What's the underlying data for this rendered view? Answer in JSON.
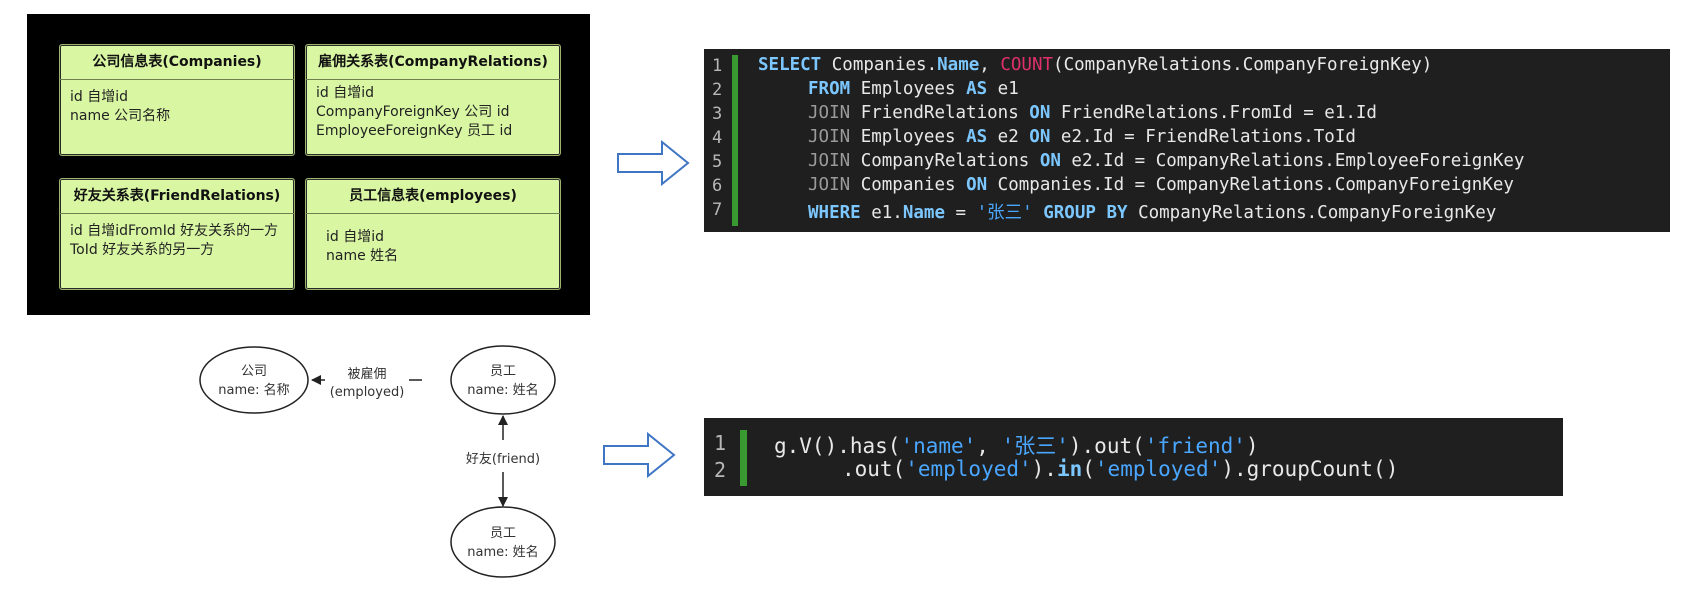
{
  "schema": {
    "companies": {
      "title": "公司信息表(Companies)",
      "fields": [
        "id 自增id",
        "name 公司名称"
      ]
    },
    "company_relations": {
      "title": "雇佣关系表(CompanyRelations)",
      "fields": [
        "id 自增id",
        "CompanyForeignKey 公司 id",
        "EmployeeForeignKey 员工 id"
      ]
    },
    "friend_relations": {
      "title": "好友关系表(FriendRelations)",
      "fields": [
        "id 自增idFromId 好友关系的一方",
        "ToId 好友关系的另一方"
      ]
    },
    "employees": {
      "title": "员工信息表(employees)",
      "fields": [
        "id 自增id",
        "name 姓名"
      ]
    }
  },
  "sql": {
    "line_numbers": [
      "1",
      "2",
      "3",
      "4",
      "5",
      "6",
      "7"
    ],
    "l1": {
      "kw1": "SELECT",
      "t1": " Companies.",
      "kw2": "Name",
      "t2": ", ",
      "fn": "COUNT",
      "t3": "(CompanyRelations.CompanyForeignKey)"
    },
    "l2": {
      "kw1": "FROM",
      "t1": " Employees ",
      "kw2": "AS",
      "t2": " e1"
    },
    "l3": {
      "jn": "JOIN",
      "t1": " FriendRelations ",
      "kw": "ON",
      "t2": " FriendRelations.FromId = e1.Id"
    },
    "l4": {
      "jn": "JOIN",
      "t1": " Employees ",
      "kw1": "AS",
      "t2": " e2 ",
      "kw2": "ON",
      "t3": " e2.Id = FriendRelations.ToId"
    },
    "l5": {
      "jn": "JOIN",
      "t1": " CompanyRelations ",
      "kw": "ON",
      "t2": " e2.Id = CompanyRelations.EmployeeForeignKey"
    },
    "l6": {
      "jn": "JOIN",
      "t1": " Companies ",
      "kw": "ON",
      "t2": " Companies.Id = CompanyRelations.CompanyForeignKey"
    },
    "l7": {
      "kw1": "WHERE",
      "t1": " e1.",
      "kw2": "Name",
      "t2": " = ",
      "str": "'张三'",
      "t3": " ",
      "kw3": "GROUP BY",
      "t4": " CompanyRelations.CompanyForeignKey"
    }
  },
  "gremlin": {
    "line_numbers": [
      "1",
      "2"
    ],
    "l1": {
      "t1": "g.V().has(",
      "s1": "'name'",
      "t2": ", ",
      "s2": "'张三'",
      "t3": ").out(",
      "s3": "'friend'",
      "t4": ")"
    },
    "l2": {
      "t1": ".out(",
      "s1": "'employed'",
      "t2": ").",
      "kw": "in",
      "t3": "(",
      "s2": "'employed'",
      "t4": ").groupCount()"
    }
  },
  "graph": {
    "company_node": {
      "line1": "公司",
      "line2": "name: 名称"
    },
    "employee_top": {
      "line1": "员工",
      "line2": "name: 姓名"
    },
    "employee_bottom": {
      "line1": "员工",
      "line2": "name: 姓名"
    },
    "edge_employed": {
      "line1": "被雇佣",
      "line2": "(employed)"
    },
    "edge_friend": "好友(friend)"
  },
  "colors": {
    "card_bg": "#d9f7a3",
    "code_bg": "#1e1f1e",
    "keyword": "#7cc7ff",
    "function": "#e0306a",
    "string": "#4aa6ff",
    "gutter_bar": "#3a9a32",
    "arrow_stroke": "#3f76c4"
  }
}
